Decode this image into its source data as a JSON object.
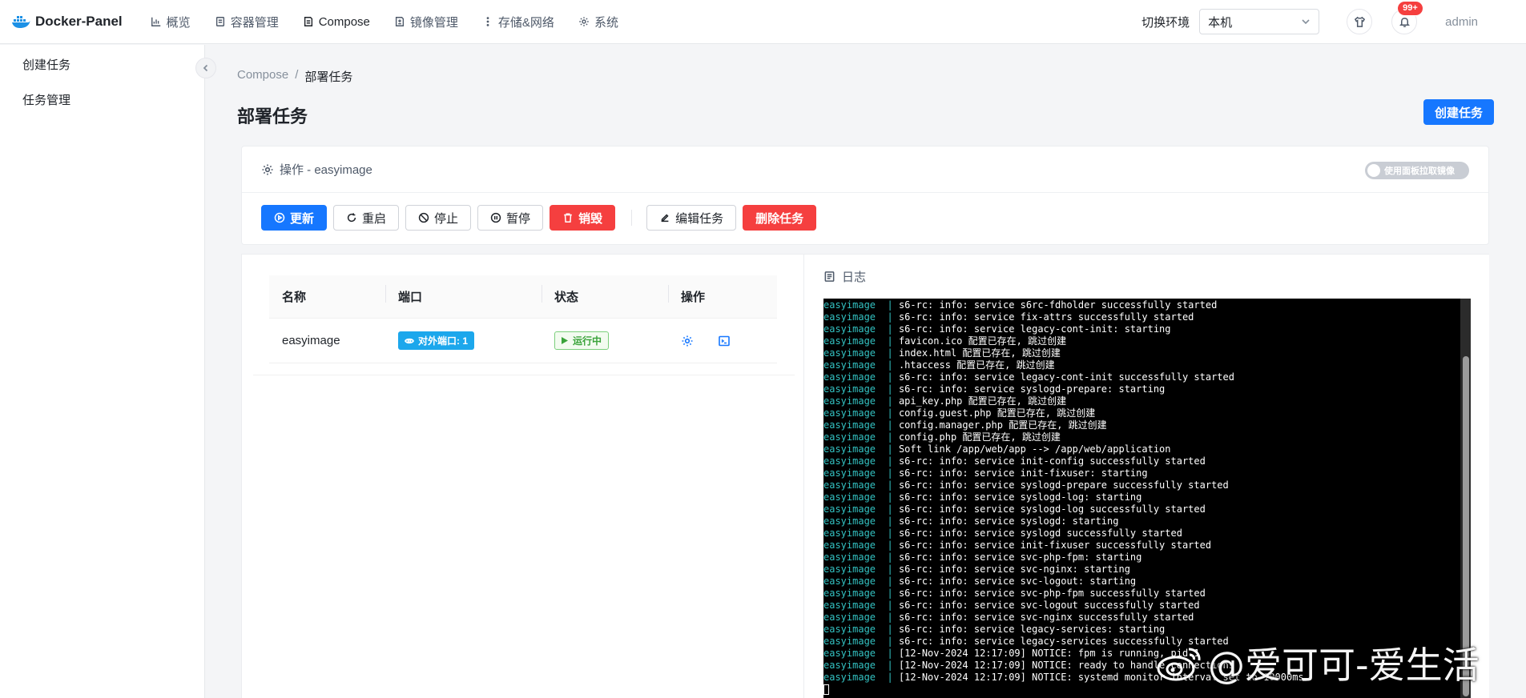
{
  "brand": {
    "name": "Docker-Panel"
  },
  "nav": {
    "items": [
      {
        "label": "概览",
        "icon": "chart-icon"
      },
      {
        "label": "容器管理",
        "icon": "container-icon"
      },
      {
        "label": "Compose",
        "icon": "compose-icon"
      },
      {
        "label": "镜像管理",
        "icon": "image-icon"
      },
      {
        "label": "存储&网络",
        "icon": "more-icon"
      },
      {
        "label": "系统",
        "icon": "gear-icon"
      }
    ],
    "env_label": "切换环境",
    "env_value": "本机",
    "notif_badge": "99+",
    "user": "admin"
  },
  "sidebar": {
    "items": [
      {
        "label": "创建任务"
      },
      {
        "label": "任务管理"
      }
    ]
  },
  "breadcrumb": {
    "root": "Compose",
    "sep": "/",
    "current": "部署任务"
  },
  "page": {
    "title": "部署任务",
    "create_button": "创建任务"
  },
  "ops": {
    "title": "操作 - easyimage",
    "toggle_label": "使用面板拉取镜像",
    "buttons": {
      "update": "更新",
      "restart": "重启",
      "stop": "停止",
      "pause": "暂停",
      "destroy": "销毁",
      "edit": "编辑任务",
      "delete": "删除任务"
    }
  },
  "table": {
    "headers": [
      "名称",
      "端口",
      "状态",
      "操作"
    ],
    "rows": [
      {
        "name": "easyimage",
        "port": "对外端口: 1",
        "status": "运行中"
      }
    ]
  },
  "logs": {
    "title": "日志",
    "source": "easyimage",
    "lines": [
      "s6-rc: info: service s6rc-fdholder successfully started",
      "s6-rc: info: service fix-attrs successfully started",
      "s6-rc: info: service legacy-cont-init: starting",
      "favicon.ico 配置已存在, 跳过创建",
      "index.html 配置已存在, 跳过创建",
      ".htaccess 配置已存在, 跳过创建",
      "s6-rc: info: service legacy-cont-init successfully started",
      "s6-rc: info: service syslogd-prepare: starting",
      "api_key.php 配置已存在, 跳过创建",
      "config.guest.php 配置已存在, 跳过创建",
      "config.manager.php 配置已存在, 跳过创建",
      "config.php 配置已存在, 跳过创建",
      "Soft link /app/web/app --> /app/web/application",
      "s6-rc: info: service init-config successfully started",
      "s6-rc: info: service init-fixuser: starting",
      "s6-rc: info: service syslogd-prepare successfully started",
      "s6-rc: info: service syslogd-log: starting",
      "s6-rc: info: service syslogd-log successfully started",
      "s6-rc: info: service syslogd: starting",
      "s6-rc: info: service syslogd successfully started",
      "s6-rc: info: service init-fixuser successfully started",
      "s6-rc: info: service svc-php-fpm: starting",
      "s6-rc: info: service svc-nginx: starting",
      "s6-rc: info: service svc-logout: starting",
      "s6-rc: info: service svc-php-fpm successfully started",
      "s6-rc: info: service svc-logout successfully started",
      "s6-rc: info: service svc-nginx successfully started",
      "s6-rc: info: service legacy-services: starting",
      "s6-rc: info: service legacy-services successfully started",
      "[12-Nov-2024 12:17:09] NOTICE: fpm is running, pid 1",
      "[12-Nov-2024 12:17:09] NOTICE: ready to handle connections",
      "[12-Nov-2024 12:17:09] NOTICE: systemd monitor interval set to 10000ms"
    ]
  },
  "watermark": {
    "text": "@爱可可-爱生活"
  },
  "colors": {
    "primary": "#1677ff",
    "danger": "#f53f3f",
    "success": "#3aa33a",
    "log_source": "#33c2c2"
  }
}
